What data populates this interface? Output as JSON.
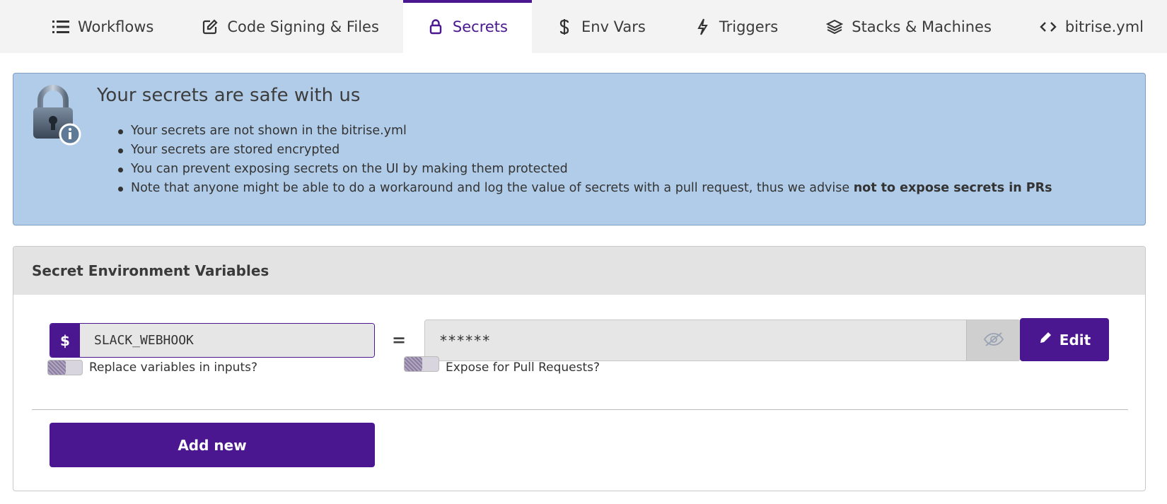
{
  "tabs": [
    {
      "label": "Workflows",
      "icon": "list-icon"
    },
    {
      "label": "Code Signing & Files",
      "icon": "edit-square-icon"
    },
    {
      "label": "Secrets",
      "icon": "lock-icon",
      "active": true
    },
    {
      "label": "Env Vars",
      "icon": "dollar-icon"
    },
    {
      "label": "Triggers",
      "icon": "lightning-icon"
    },
    {
      "label": "Stacks & Machines",
      "icon": "layers-icon"
    },
    {
      "label": "bitrise.yml",
      "icon": "code-icon"
    }
  ],
  "banner": {
    "title": "Your secrets are safe with us",
    "items": [
      "Your secrets are not shown in the bitrise.yml",
      "Your secrets are stored encrypted",
      "You can prevent exposing secrets on the UI by making them protected"
    ],
    "last_item_text": "Note that anyone might be able to do a workaround and log the value of secrets with a pull request, thus we advise ",
    "last_item_bold": "not to expose secrets in PRs",
    "icon": "padlock-info-icon",
    "color": "#b1cce8"
  },
  "panel": {
    "title": "Secret Environment Variables",
    "variable": {
      "prefix": "$",
      "key": "SLACK_WEBHOOK",
      "equals": "=",
      "value": "******",
      "edit_label": "Edit"
    },
    "replace_toggle_label": "Replace variables in inputs?",
    "expose_toggle_label": "Expose for Pull Requests?",
    "add_label": "Add new"
  },
  "colors": {
    "accent": "#4b1790",
    "tabbar_bg": "#f3f3f3",
    "panel_header_bg": "#e3e3e3"
  }
}
